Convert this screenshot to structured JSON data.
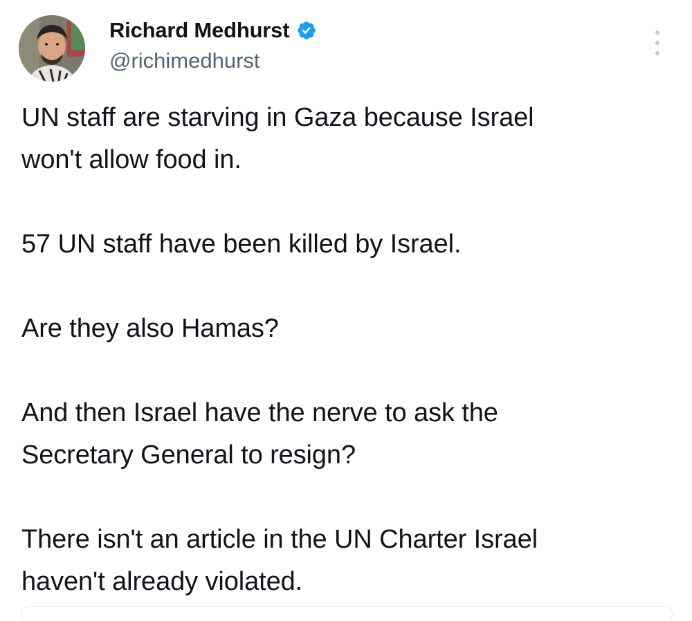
{
  "author": {
    "display_name": "Richard Medhurst",
    "handle": "@richimedhurst",
    "verified": true,
    "avatar_icon": "profile-photo",
    "verified_color": "#1d9bf0"
  },
  "menu": {
    "icon": "more-vertical-icon"
  },
  "tweet": {
    "lines": [
      "UN staff are starving in Gaza because Israel",
      "won't allow food in.",
      "57 UN staff have been killed by Israel.",
      "Are they also Hamas?",
      "And then Israel have the nerve to ask the",
      "Secretary General to resign?",
      "There isn't an article in the UN Charter Israel",
      "haven't already violated."
    ]
  }
}
